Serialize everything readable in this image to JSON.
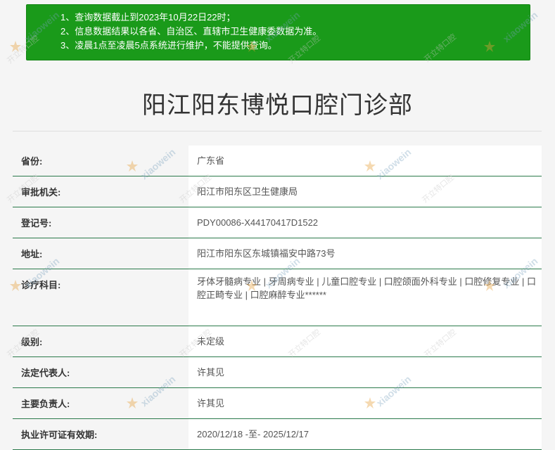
{
  "notice": {
    "lines": [
      "1、查询数据截止到2023年10月22日22时；",
      "2、信息数据结果以各省、自治区、直辖市卫生健康委数据为准。",
      "3、凌晨1点至凌晨5点系统进行维护，不能提供查询。"
    ]
  },
  "title": "阳江阳东博悦口腔门诊部",
  "rows": [
    {
      "label": "省份:",
      "value": "广东省"
    },
    {
      "label": "审批机关:",
      "value": "阳江市阳东区卫生健康局"
    },
    {
      "label": "登记号:",
      "value": "PDY00086-X44170417D1522"
    },
    {
      "label": "地址:",
      "value": "阳江市阳东区东城镇福安中路73号"
    },
    {
      "label": "诊疗科目:",
      "value": "牙体牙髓病专业 | 牙周病专业 | 儿童口腔专业 | 口腔颌面外科专业 | 口腔修复专业 | 口腔正畸专业 | 口腔麻醉专业******"
    },
    {
      "label": "级别:",
      "value": "未定级"
    },
    {
      "label": "法定代表人:",
      "value": "许其见"
    },
    {
      "label": "主要负责人:",
      "value": "许其见"
    },
    {
      "label": "执业许可证有效期:",
      "value": "2020/12/18 -至- 2025/12/17"
    }
  ],
  "watermark": {
    "text": "xiaowein",
    "text2": "开立特口腔"
  }
}
